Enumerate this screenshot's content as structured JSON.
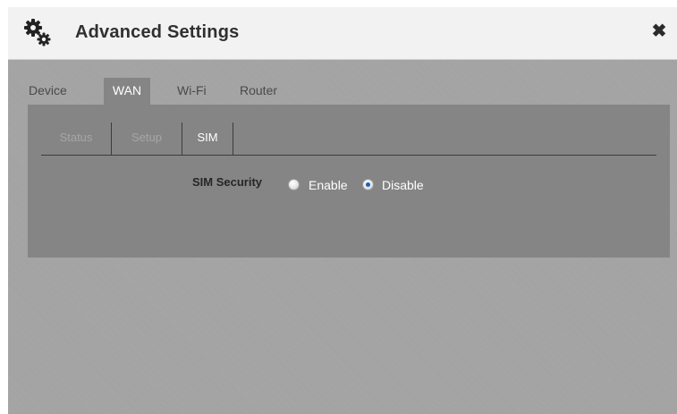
{
  "dialog": {
    "title": "Advanced Settings",
    "title_icon": "gears-icon",
    "close_label": "✖"
  },
  "main_tabs": [
    {
      "label": "Device",
      "active": false
    },
    {
      "label": "WAN",
      "active": true
    },
    {
      "label": "Wi-Fi",
      "active": false
    },
    {
      "label": "Router",
      "active": false
    }
  ],
  "sub_tabs": [
    {
      "label": "Status",
      "active": false
    },
    {
      "label": "Setup",
      "active": false
    },
    {
      "label": "SIM",
      "active": true
    }
  ],
  "sim": {
    "security_label": "SIM Security",
    "options": [
      {
        "label": "Enable",
        "checked": false
      },
      {
        "label": "Disable",
        "checked": true
      }
    ]
  },
  "colors": {
    "radio_checked": "#1f5fb5",
    "panel": "#858585",
    "background": "#a5a5a5"
  }
}
